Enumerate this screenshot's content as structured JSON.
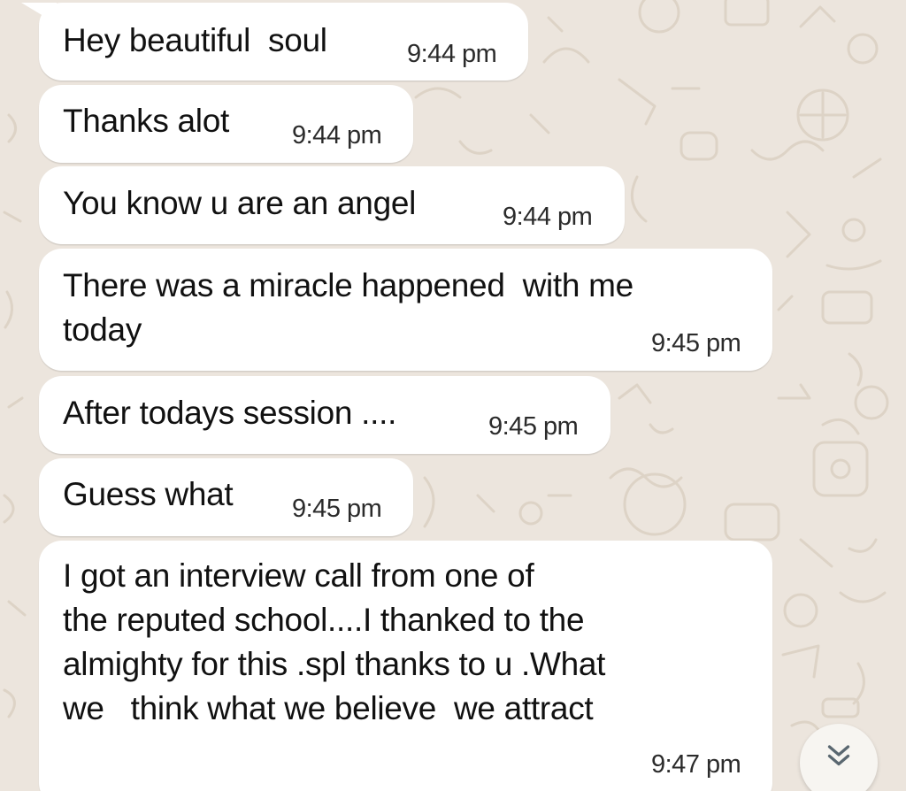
{
  "colors": {
    "chat_background": "#ece5dd",
    "bubble_incoming": "#ffffff",
    "message_text": "#111111",
    "timestamp_text": "#2b2b2b"
  },
  "messages": [
    {
      "text": "Hey beautiful  soul",
      "time": "9:44 pm"
    },
    {
      "text": "Thanks alot",
      "time": "9:44 pm"
    },
    {
      "text": "You know u are an angel",
      "time": "9:44 pm"
    },
    {
      "text": "There was a miracle happened  with me\ntoday",
      "time": "9:45 pm"
    },
    {
      "text": "After todays session ....",
      "time": "9:45 pm"
    },
    {
      "text": "Guess what",
      "time": "9:45 pm"
    },
    {
      "text": "I got an interview call from one of\nthe reputed school....I thanked to the\nalmighty for this .spl thanks to u .What\nwe   think what we believe  we attract",
      "time": "9:47 pm"
    }
  ],
  "scroll_button": {
    "icon": "double-chevron-down-icon"
  }
}
